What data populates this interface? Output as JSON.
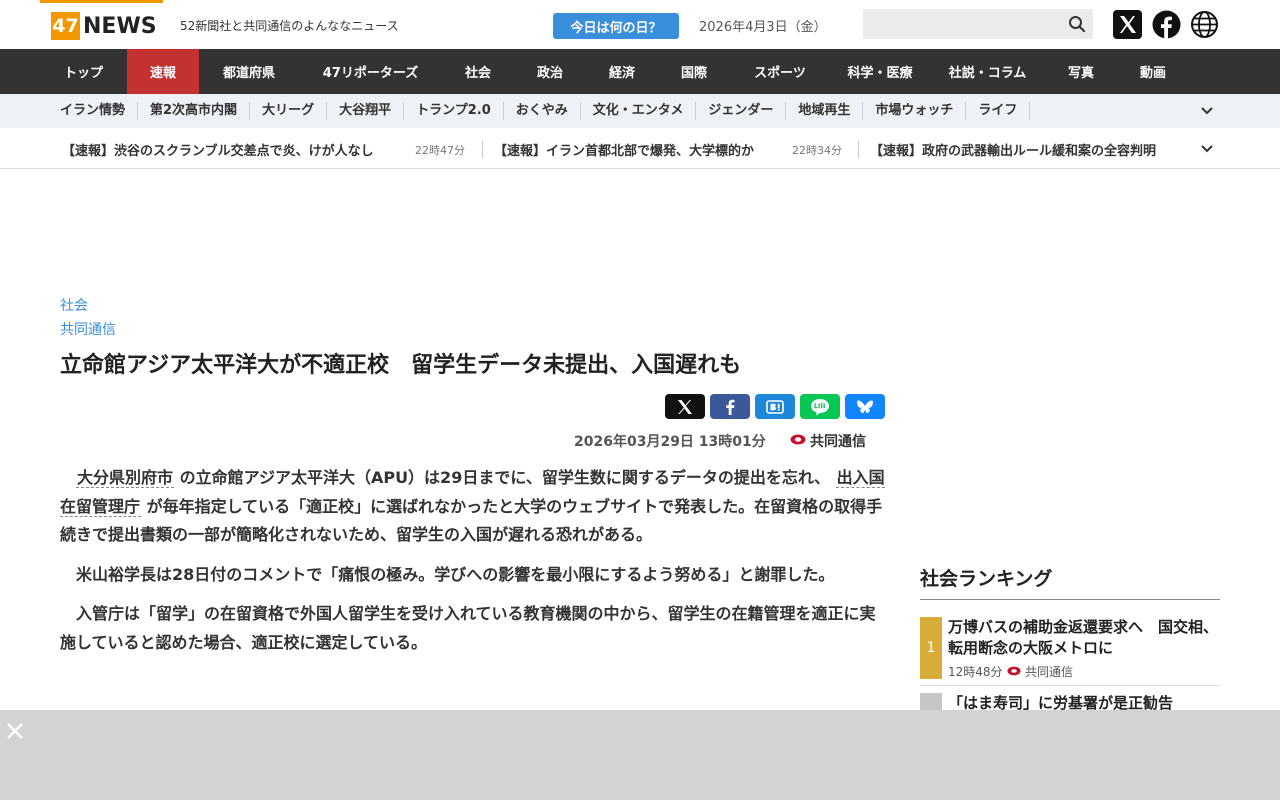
{
  "header": {
    "logo_num": "47",
    "logo_word": "NEWS",
    "tagline": "52新聞社と共同通信のよんななニュース",
    "today_button": "今日は何の日？",
    "today_date": "2026年4月3日（金）",
    "search_placeholder": ""
  },
  "nav": [
    "トップ",
    "速報",
    "都道府県",
    "47リポーターズ",
    "社会",
    "政治",
    "経済",
    "国際",
    "スポーツ",
    "科学・医療",
    "社説・コラム",
    "写真",
    "動画"
  ],
  "subnav": [
    "イラン情勢",
    "第2次高市内閣",
    "大リーグ",
    "大谷翔平",
    "トランプ2.0",
    "おくやみ",
    "文化・エンタメ",
    "ジェンダー",
    "地域再生",
    "市場ウォッチ",
    "ライフ"
  ],
  "ticker": [
    {
      "text": "【速報】渋谷のスクランブル交差点で炎、けが人なし",
      "time": "22時47分"
    },
    {
      "text": "【速報】イラン首都北部で爆発、大学標的か",
      "time": "22時34分"
    },
    {
      "text": "【速報】政府の武器輸出ルール緩和案の全容判明",
      "time": ""
    }
  ],
  "article": {
    "category": "社会",
    "source": "共同通信",
    "title": "立命館アジア太平洋大が不適正校　留学生データ未提出、入国遅れも",
    "date": "2026年03月29日 13時01分",
    "date_source": "共同通信",
    "p1_term1": "大分県別府市",
    "p1_a": "の立命館アジア太平洋大（APU）は29日までに、留学生数に関するデータの提出を忘れ、",
    "p1_term2": "出入国在留管理庁",
    "p1_b": "が毎年指定している「適正校」に選ばれなかったと大学のウェブサイトで発表した。在留資格の取得手続きで提出書類の一部が簡略化されないため、留学生の入国が遅れる恐れがある。",
    "p2": "米山裕学長は28日付のコメントで「痛恨の極み。学びへの影響を最小限にするよう努める」と謝罪した。",
    "p3": "入管庁は「留学」の在留資格で外国人留学生を受け入れている教育機関の中から、留学生の在籍管理を適正に実施していると認めた場合、適正校に選定している。"
  },
  "ranking": {
    "title": "社会ランキング",
    "items": [
      {
        "rank": "1",
        "text": "万博バスの補助金返還要求へ　国交相、転用断念の大阪メトロに",
        "time": "12時48分",
        "source": "共同通信"
      },
      {
        "rank": "",
        "text": "「はま寿司」に労基署が是正勧告",
        "time": "",
        "source": ""
      }
    ]
  },
  "colors": {
    "accent_orange": "#f39800",
    "nav_bg": "#333333",
    "nav_active": "#c33131",
    "link_blue": "#3a8fdc",
    "rank_gold": "#d9ac3a"
  }
}
